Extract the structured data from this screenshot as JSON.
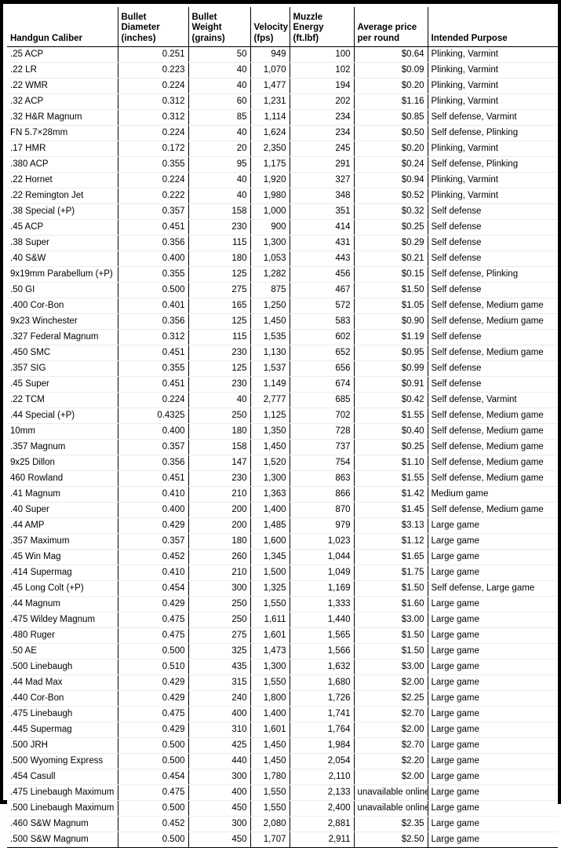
{
  "table": {
    "columns": [
      {
        "key": "caliber",
        "label": "Handgun Caliber",
        "align": "left"
      },
      {
        "key": "diameter",
        "label": "Bullet Diameter\n(inches)",
        "align": "right"
      },
      {
        "key": "weight",
        "label": "Bullet Weight\n(grains)",
        "align": "right"
      },
      {
        "key": "velocity",
        "label": "Velocity\n(fps)",
        "align": "right"
      },
      {
        "key": "energy",
        "label": "Muzzle Energy\n(ft.lbf)",
        "align": "right"
      },
      {
        "key": "price",
        "label": "Average price\nper round",
        "align": "right"
      },
      {
        "key": "purpose",
        "label": "Intended Purpose",
        "align": "left"
      }
    ],
    "rows": [
      [
        ".25 ACP",
        "0.251",
        "50",
        "949",
        "100",
        "$0.64",
        "Plinking, Varmint"
      ],
      [
        ".22 LR",
        "0.223",
        "40",
        "1,070",
        "102",
        "$0.09",
        "Plinking, Varmint"
      ],
      [
        ".22 WMR",
        "0.224",
        "40",
        "1,477",
        "194",
        "$0.20",
        "Plinking, Varmint"
      ],
      [
        ".32 ACP",
        "0.312",
        "60",
        "1,231",
        "202",
        "$1.16",
        "Plinking, Varmint"
      ],
      [
        ".32 H&R Magnum",
        "0.312",
        "85",
        "1,114",
        "234",
        "$0.85",
        "Self defense, Varmint"
      ],
      [
        "FN 5.7×28mm",
        "0.224",
        "40",
        "1,624",
        "234",
        "$0.50",
        "Self defense, Plinking"
      ],
      [
        ".17 HMR",
        "0.172",
        "20",
        "2,350",
        "245",
        "$0.20",
        "Plinking, Varmint"
      ],
      [
        ".380 ACP",
        "0.355",
        "95",
        "1,175",
        "291",
        "$0.24",
        "Self defense, Plinking"
      ],
      [
        ".22 Hornet",
        "0.224",
        "40",
        "1,920",
        "327",
        "$0.94",
        "Plinking, Varmint"
      ],
      [
        ".22 Remington Jet",
        "0.222",
        "40",
        "1,980",
        "348",
        "$0.52",
        "Plinking, Varmint"
      ],
      [
        ".38 Special (+P)",
        "0.357",
        "158",
        "1,000",
        "351",
        "$0.32",
        "Self defense"
      ],
      [
        ".45 ACP",
        "0.451",
        "230",
        "900",
        "414",
        "$0.25",
        "Self defense"
      ],
      [
        ".38 Super",
        "0.356",
        "115",
        "1,300",
        "431",
        "$0.29",
        "Self defense"
      ],
      [
        ".40 S&W",
        "0.400",
        "180",
        "1,053",
        "443",
        "$0.21",
        "Self defense"
      ],
      [
        "9x19mm Parabellum (+P)",
        "0.355",
        "125",
        "1,282",
        "456",
        "$0.15",
        "Self defense, Plinking"
      ],
      [
        ".50 GI",
        "0.500",
        "275",
        "875",
        "467",
        "$1.50",
        "Self defense"
      ],
      [
        ".400 Cor-Bon",
        "0.401",
        "165",
        "1,250",
        "572",
        "$1.05",
        "Self defense, Medium game"
      ],
      [
        "9x23 Winchester",
        "0.356",
        "125",
        "1,450",
        "583",
        "$0.90",
        "Self defense, Medium game"
      ],
      [
        ".327 Federal Magnum",
        "0.312",
        "115",
        "1,535",
        "602",
        "$1.19",
        "Self defense"
      ],
      [
        ".450 SMC",
        "0.451",
        "230",
        "1,130",
        "652",
        "$0.95",
        "Self defense, Medium game"
      ],
      [
        ".357 SIG",
        "0.355",
        "125",
        "1,537",
        "656",
        "$0.99",
        "Self defense"
      ],
      [
        ".45 Super",
        "0.451",
        "230",
        "1,149",
        "674",
        "$0.91",
        "Self defense"
      ],
      [
        ".22 TCM",
        "0.224",
        "40",
        "2,777",
        "685",
        "$0.42",
        "Self defense, Varmint"
      ],
      [
        ".44 Special (+P)",
        "0.4325",
        "250",
        "1,125",
        "702",
        "$1.55",
        "Self defense, Medium game"
      ],
      [
        "10mm",
        "0.400",
        "180",
        "1,350",
        "728",
        "$0.40",
        "Self defense, Medium game"
      ],
      [
        ".357 Magnum",
        "0.357",
        "158",
        "1,450",
        "737",
        "$0.25",
        "Self defense, Medium game"
      ],
      [
        "9x25 Dillon",
        "0.356",
        "147",
        "1,520",
        "754",
        "$1.10",
        "Self defense, Medium game"
      ],
      [
        "460 Rowland",
        "0.451",
        "230",
        "1,300",
        "863",
        "$1.55",
        "Self defense, Medium game"
      ],
      [
        ".41 Magnum",
        "0.410",
        "210",
        "1,363",
        "866",
        "$1.42",
        "Medium game"
      ],
      [
        ".40 Super",
        "0.400",
        "200",
        "1,400",
        "870",
        "$1.45",
        "Self defense, Medium game"
      ],
      [
        ".44 AMP",
        "0.429",
        "200",
        "1,485",
        "979",
        "$3.13",
        "Large game"
      ],
      [
        ".357 Maximum",
        "0.357",
        "180",
        "1,600",
        "1,023",
        "$1.12",
        "Large game"
      ],
      [
        ".45 Win Mag",
        "0.452",
        "260",
        "1,345",
        "1,044",
        "$1.65",
        "Large game"
      ],
      [
        ".414 Supermag",
        "0.410",
        "210",
        "1,500",
        "1,049",
        "$1.75",
        "Large game"
      ],
      [
        ".45 Long Colt (+P)",
        "0.454",
        "300",
        "1,325",
        "1,169",
        "$1.50",
        "Self defense, Large game"
      ],
      [
        ".44 Magnum",
        "0.429",
        "250",
        "1,550",
        "1,333",
        "$1.60",
        "Large game"
      ],
      [
        ".475 Wildey Magnum",
        "0.475",
        "250",
        "1,611",
        "1,440",
        "$3.00",
        "Large game"
      ],
      [
        ".480 Ruger",
        "0.475",
        "275",
        "1,601",
        "1,565",
        "$1.50",
        "Large game"
      ],
      [
        ".50 AE",
        "0.500",
        "325",
        "1,473",
        "1,566",
        "$1.50",
        "Large game"
      ],
      [
        ".500 Linebaugh",
        "0.510",
        "435",
        "1,300",
        "1,632",
        "$3.00",
        "Large game"
      ],
      [
        ".44 Mad Max",
        "0.429",
        "315",
        "1,550",
        "1,680",
        "$2.00",
        "Large game"
      ],
      [
        ".440 Cor-Bon",
        "0.429",
        "240",
        "1,800",
        "1,726",
        "$2.25",
        "Large game"
      ],
      [
        ".475 Linebaugh",
        "0.475",
        "400",
        "1,400",
        "1,741",
        "$2.70",
        "Large game"
      ],
      [
        ".445 Supermag",
        "0.429",
        "310",
        "1,601",
        "1,764",
        "$2.00",
        "Large game"
      ],
      [
        ".500 JRH",
        "0.500",
        "425",
        "1,450",
        "1,984",
        "$2.70",
        "Large game"
      ],
      [
        ".500 Wyoming Express",
        "0.500",
        "440",
        "1,450",
        "2,054",
        "$2.20",
        "Large game"
      ],
      [
        ".454 Casull",
        "0.454",
        "300",
        "1,780",
        "2,110",
        "$2.00",
        "Large game"
      ],
      [
        ".475 Linebaugh Maximum",
        "0.475",
        "400",
        "1,550",
        "2,133",
        "unavailable online",
        "Large game"
      ],
      [
        ".500 Linebaugh Maximum",
        "0.500",
        "450",
        "1,550",
        "2,400",
        "unavailable online",
        "Large game"
      ],
      [
        ".460 S&W Magnum",
        "0.452",
        "300",
        "2,080",
        "2,881",
        "$2.35",
        "Large game"
      ],
      [
        ".500 S&W Magnum",
        "0.500",
        "450",
        "1,707",
        "2,911",
        "$2.50",
        "Large game"
      ]
    ]
  }
}
